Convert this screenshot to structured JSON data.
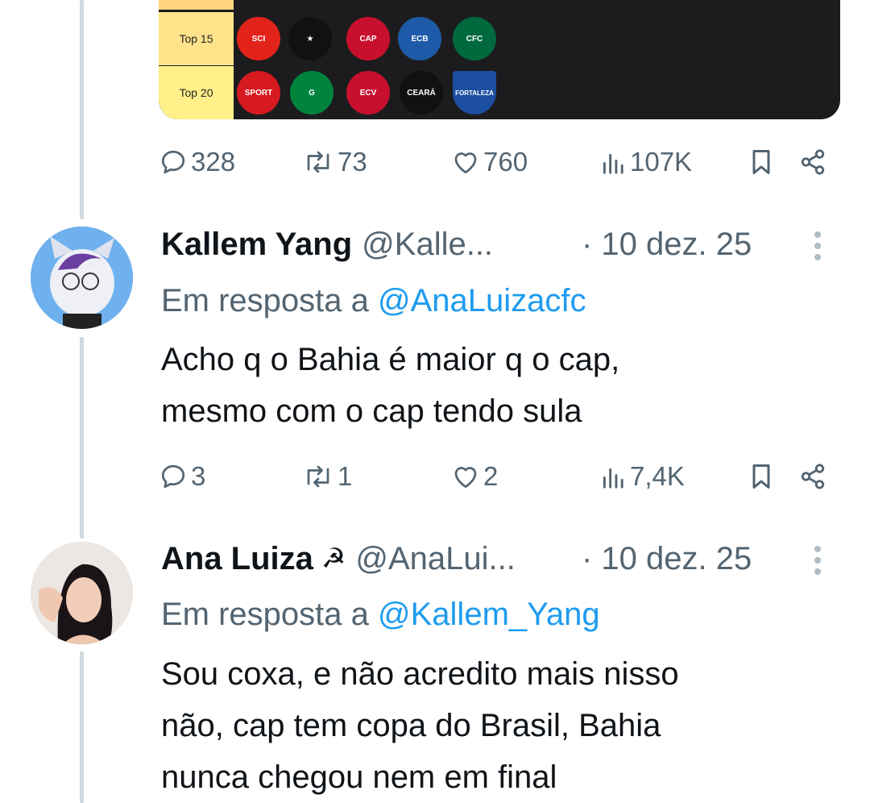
{
  "tier_image": {
    "rows": [
      {
        "label": ""
      },
      {
        "label": "Top 15",
        "crests": [
          {
            "name": "internacional-crest",
            "bg": "#e2231a",
            "text": "SCI"
          },
          {
            "name": "botafogo-crest",
            "bg": "#111111",
            "text": "★"
          },
          {
            "name": "athletico-crest",
            "bg": "#c8102e",
            "text": "CAP"
          },
          {
            "name": "bahia-crest",
            "bg": "#1e5aa8",
            "text": "ECB"
          },
          {
            "name": "coritiba-crest",
            "bg": "#00693e",
            "text": "CFC"
          }
        ]
      },
      {
        "label": "Top 20",
        "crests": [
          {
            "name": "sport-crest",
            "bg": "#d71920",
            "text": "SPORT"
          },
          {
            "name": "goias-crest",
            "bg": "#00843d",
            "text": "G"
          },
          {
            "name": "vitoria-crest",
            "bg": "#c8102e",
            "text": "ECV"
          },
          {
            "name": "ceara-crest",
            "bg": "#111111",
            "text": "CEARÁ"
          },
          {
            "name": "fortaleza-crest",
            "bg": "#1d4fa0",
            "text": "FORTALEZA"
          }
        ]
      }
    ]
  },
  "original_tweet": {
    "stats": {
      "replies": "328",
      "reposts": "73",
      "likes": "760",
      "views": "107K"
    }
  },
  "replies": [
    {
      "name": "Kallem Yang",
      "handle": "@Kalle...",
      "date": "· 10 dez. 25",
      "reply_prefix": "Em resposta a ",
      "reply_to": "@AnaLuizacfc",
      "text_lines": [
        "Acho q o Bahia é maior q o cap,",
        "mesmo com o cap tendo sula"
      ],
      "stats": {
        "replies": "3",
        "reposts": "1",
        "likes": "2",
        "views": "7,4K"
      }
    },
    {
      "name": "Ana Luiza",
      "name_emoji": "☭",
      "handle": "@AnaLui...",
      "date": "· 10 dez. 25",
      "reply_prefix": "Em resposta a ",
      "reply_to": "@Kallem_Yang",
      "text_lines": [
        "Sou coxa, e não acredito mais nisso",
        "não, cap tem copa do Brasil, Bahia",
        "nunca chegou nem em final"
      ]
    }
  ],
  "colors": {
    "link": "#1d9bf0",
    "muted": "#536471",
    "thread_line": "#cfd9de"
  }
}
